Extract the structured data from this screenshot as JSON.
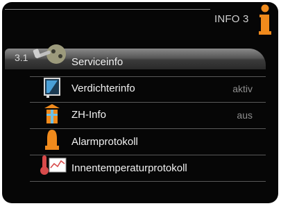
{
  "header": {
    "title": "INFO 3"
  },
  "menu": {
    "selected_number": "3.1",
    "items": [
      {
        "label": "Serviceinfo",
        "status": ""
      },
      {
        "label": "Verdichterinfo",
        "status": "aktiv"
      },
      {
        "label": "ZH-Info",
        "status": "aus"
      },
      {
        "label": "Alarmprotokoll",
        "status": ""
      },
      {
        "label": "Innentemperaturprotokoll",
        "status": ""
      }
    ]
  },
  "colors": {
    "accent_orange": "#f08a1c",
    "background": "#060606",
    "text": "#f2f2f2",
    "status_text": "#8e8e8e"
  },
  "icons": [
    "info-icon",
    "service-icon",
    "compressor-icon",
    "heater-icon",
    "alarm-bell-icon",
    "temperature-log-icon"
  ]
}
